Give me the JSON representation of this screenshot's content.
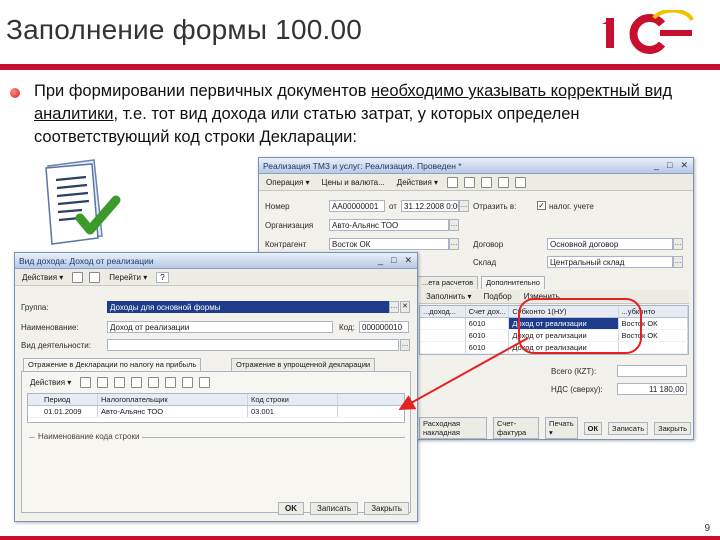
{
  "slide": {
    "title": "Заполнение формы 100.00",
    "bullet_part1": "При формировании первичных документов ",
    "bullet_underline1": "необходимо указывать корректный вид аналитики",
    "bullet_part2": ", т.е. тот вид дохода или статью затрат, у которых определен соответствующий код строки Декларации:",
    "page_number": "9",
    "logo_text": "1С"
  },
  "back_window": {
    "title": "Реализация ТМЗ и услуг: Реализация. Проведен *",
    "toolbar": [
      "Операция ▾",
      "Цены и валюта...",
      "Действия ▾"
    ],
    "fields": {
      "number_label": "Номер",
      "number_value": "АА00000001",
      "date_label": "от",
      "date_value": "31.12.2008 0:00:00",
      "org_label": "Организация",
      "org_value": "Авто-Альянс ТОО",
      "contractor_label": "Контрагент",
      "contractor_value": "Восток ОК",
      "reflect_label": "Отразить в:",
      "reflect_value": "налог. учете",
      "contract_label": "Договор",
      "contract_value": "Основной договор",
      "warehouse_label": "Склад",
      "warehouse_value": "Центральный склад"
    },
    "tabs": [
      "...ета расчетов",
      "Дополнительно"
    ],
    "grid_toolbar": [
      "Заполнить ▾",
      "Подбор",
      "Изменить"
    ],
    "grid_headers": [
      "...доход...",
      "Счет дох...",
      "Субконто 1(НУ)",
      "...убконто"
    ],
    "grid_rows": [
      [
        "",
        "6010",
        "Доход от реализации",
        "Восток ОК"
      ],
      [
        "",
        "6010",
        "Доход от реализации",
        "Восток ОК"
      ],
      [
        "",
        "6010",
        "Доход от реализации",
        ""
      ]
    ],
    "totals": {
      "total_label": "Всего (КZT):",
      "total_value": "",
      "vat_label": "НДС (сверху):",
      "vat_value": "11 180,00"
    },
    "bottom_buttons": [
      "Расходная накладная",
      "Счет-фактура",
      "Печать ▾",
      "ОК",
      "Записать",
      "Закрыть"
    ]
  },
  "front_window": {
    "title": "Вид дохода: Доход от реализации",
    "toolbar": [
      "Действия ▾",
      "Перейти ▾",
      "?"
    ],
    "fields": {
      "group_label": "Группа:",
      "group_value": "Доходы для основной формы",
      "name_label": "Наименование:",
      "name_value": "Доход от реализации",
      "code_label": "Код:",
      "code_value": "000000010",
      "activity_label": "Вид деятельности:",
      "activity_value": ""
    },
    "tabs": [
      "Отражение в Декларации по налогу на прибыль",
      "Отражение в упрощенной декларации"
    ],
    "grid_toolbar": [
      "Действия ▾"
    ],
    "grid_headers": [
      "Период",
      "Налогоплательщик",
      "Код строки"
    ],
    "grid_rows": [
      [
        "01.01.2009",
        "Авто-Альянс ТОО",
        "03.001"
      ]
    ],
    "group_box_label": "Наименование кода строки",
    "bottom_buttons": [
      "OK",
      "Записать",
      "Закрыть"
    ]
  },
  "colors": {
    "accent": "#c8102e",
    "selection": "#1e3b8c",
    "highlight_ring": "#e52222"
  }
}
